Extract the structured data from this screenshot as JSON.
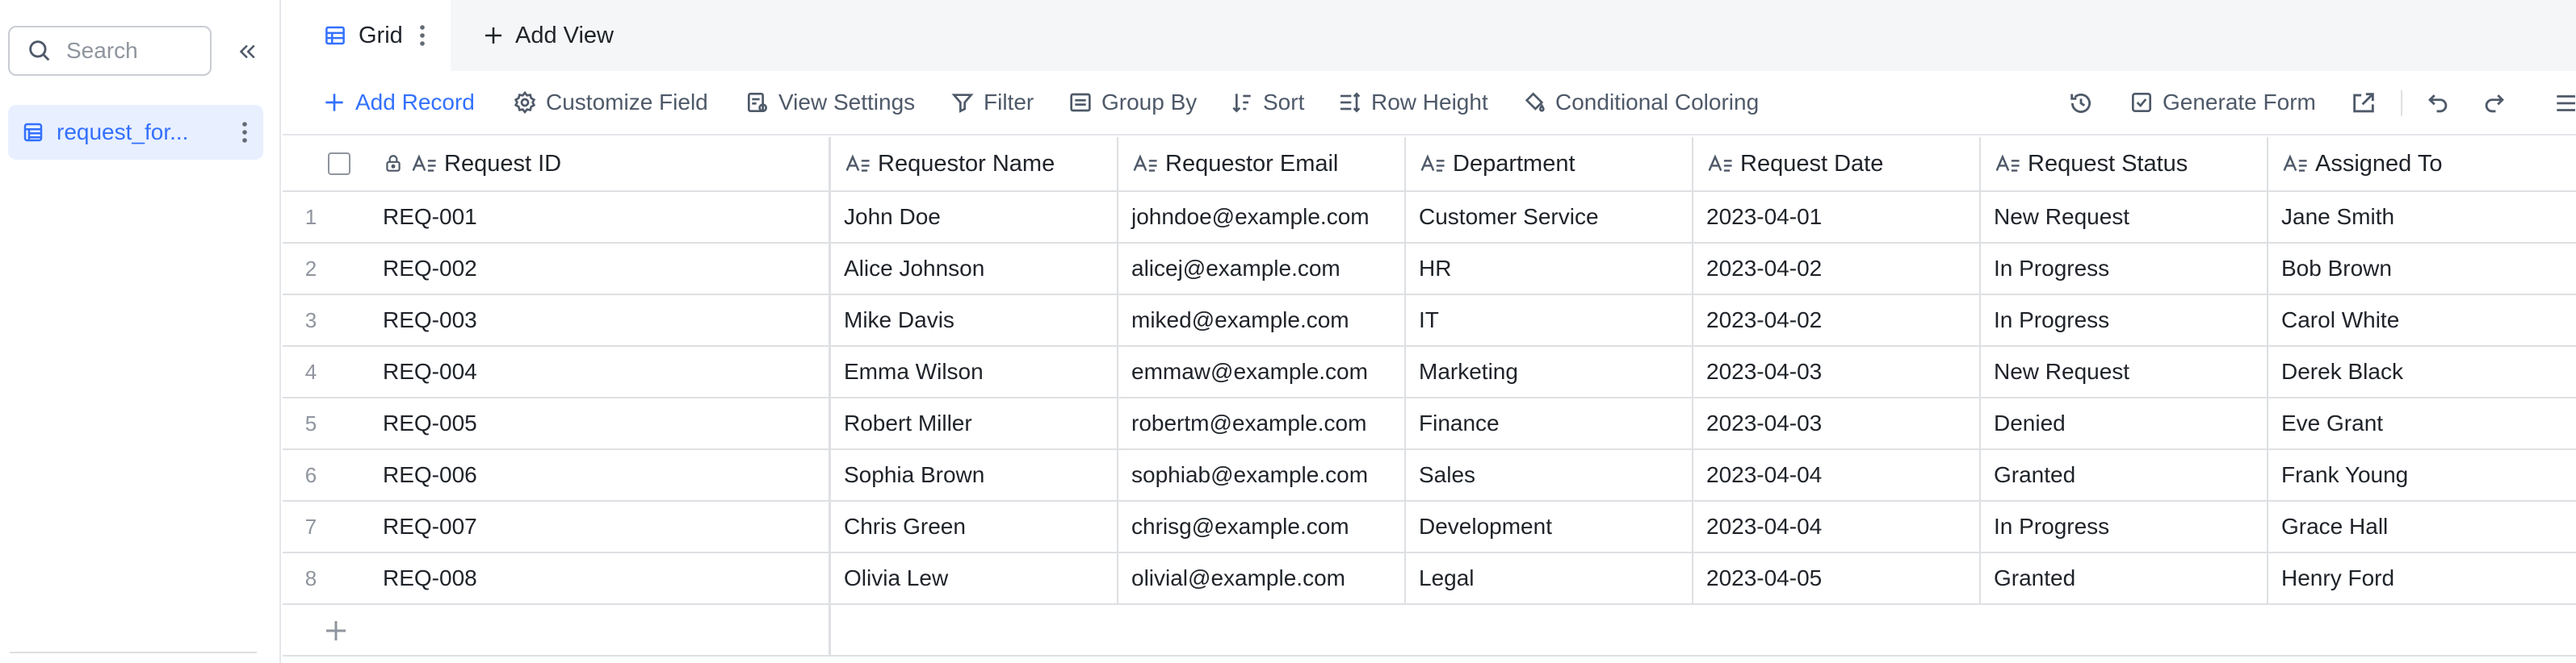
{
  "sidebar": {
    "search_placeholder": "Search",
    "table_name": "request_for..."
  },
  "viewbar": {
    "active_view": "Grid",
    "add_view_label": "Add View"
  },
  "toolbar": {
    "add_record": "Add Record",
    "customize_field": "Customize Field",
    "view_settings": "View Settings",
    "filter": "Filter",
    "group_by": "Group By",
    "sort": "Sort",
    "row_height": "Row Height",
    "conditional_coloring": "Conditional Coloring",
    "generate_form": "Generate Form"
  },
  "grid": {
    "columns": [
      "Request ID",
      "Requestor Name",
      "Requestor Email",
      "Department",
      "Request Date",
      "Request Status",
      "Assigned To"
    ],
    "rows": [
      {
        "num": "1",
        "cells": [
          "REQ-001",
          "John Doe",
          "johndoe@example.com",
          "Customer Service",
          "2023-04-01",
          "New Request",
          "Jane Smith"
        ]
      },
      {
        "num": "2",
        "cells": [
          "REQ-002",
          "Alice Johnson",
          "alicej@example.com",
          "HR",
          "2023-04-02",
          "In Progress",
          "Bob Brown"
        ]
      },
      {
        "num": "3",
        "cells": [
          "REQ-003",
          "Mike Davis",
          "miked@example.com",
          "IT",
          "2023-04-02",
          "In Progress",
          "Carol White"
        ]
      },
      {
        "num": "4",
        "cells": [
          "REQ-004",
          "Emma Wilson",
          "emmaw@example.com",
          "Marketing",
          "2023-04-03",
          "New Request",
          "Derek Black"
        ]
      },
      {
        "num": "5",
        "cells": [
          "REQ-005",
          "Robert Miller",
          "robertm@example.com",
          "Finance",
          "2023-04-03",
          "Denied",
          "Eve Grant"
        ]
      },
      {
        "num": "6",
        "cells": [
          "REQ-006",
          "Sophia Brown",
          "sophiab@example.com",
          "Sales",
          "2023-04-04",
          "Granted",
          "Frank Young"
        ]
      },
      {
        "num": "7",
        "cells": [
          "REQ-007",
          "Chris Green",
          "chrisg@example.com",
          "Development",
          "2023-04-04",
          "In Progress",
          "Grace Hall"
        ]
      },
      {
        "num": "8",
        "cells": [
          "REQ-008",
          "Olivia Lew",
          "olivial@example.com",
          "Legal",
          "2023-04-05",
          "Granted",
          "Henry Ford"
        ]
      }
    ]
  },
  "colors": {
    "accent": "#3370ff",
    "selected_bg": "#e8f0ff",
    "border": "#dee0e3",
    "text": "#1f2329",
    "muted_text": "#4e5969"
  }
}
